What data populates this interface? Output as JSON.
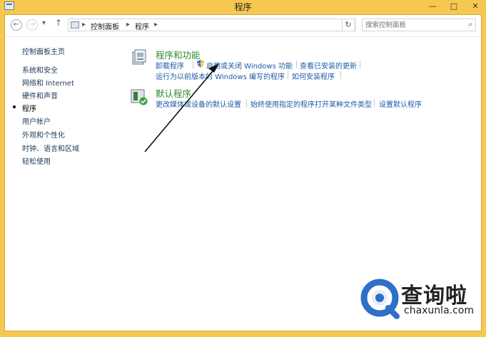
{
  "window": {
    "title": "程序"
  },
  "titlebar": {
    "minimize": "—",
    "maximize": "□",
    "close": "✕"
  },
  "address": {
    "back": "←",
    "forward": "→",
    "history": "▾",
    "up": "↑",
    "crumbs": [
      "控制面板",
      "程序"
    ],
    "separator": "▸",
    "dropdown": "⌄",
    "refresh": "↻",
    "search_placeholder": "搜索控制面板",
    "search_icon": "⌕"
  },
  "sidebar": {
    "home": "控制面板主页",
    "items": [
      {
        "label": "系统和安全"
      },
      {
        "label": "网络和 Internet"
      },
      {
        "label": "硬件和声音"
      },
      {
        "label": "程序",
        "current": true
      },
      {
        "label": "用户帐户"
      },
      {
        "label": "外观和个性化"
      },
      {
        "label": "时钟、语言和区域"
      },
      {
        "label": "轻松使用"
      }
    ]
  },
  "main": {
    "programs": {
      "title": "程序和功能",
      "links_row1": [
        "卸载程序",
        "启用或关闭 Windows 功能",
        "查看已安装的更新"
      ],
      "links_row2": [
        "运行为以前版本的 Windows 编写的程序",
        "如何安装程序"
      ]
    },
    "defaults": {
      "title": "默认程序",
      "links": [
        "更改媒体或设备的默认设置",
        "始终使用指定的程序打开某种文件类型",
        "设置默认程序"
      ]
    }
  },
  "watermark": {
    "name": "查询啦",
    "url": "chaxunla.com"
  },
  "colors": {
    "frame": "#F7C84F",
    "link": "#1e5aa8",
    "section_title": "#2f8a2f",
    "sidebar_link": "#1e3a5a"
  }
}
